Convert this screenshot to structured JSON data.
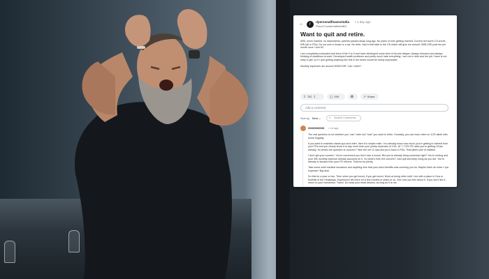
{
  "post": {
    "subreddit": "r/personalfinanceindia",
    "time": "• 1 day ago",
    "flair": "Proud Conservative/ABC",
    "title": "Want to quit and retire.",
    "body": [
      "60M, never married, no dependents, parents passed away long ago. No plans of ever getting married. Current net worth 2.5 crores INR (all in FDs). Do not own a house or a car. No debt. Had a brief stint in the US which will give me around 150$ USD post tax per month once I turn 62.",
      "I am completely exhausted and tired of the 9 to 5 and have developed some kind of chronic fatigue. Always stressed and always thinking of deadlines at work. Developed health problems and pretty much hate everything. I am not in debt and the job I have is not easy to get, so if I quit getting anything like this in the future would be nearly impossible.",
      "Monthly expenses are around 30000 INR. Can I retire?"
    ],
    "actions": {
      "upvotes": "752",
      "comments": "299",
      "awards": "",
      "share": "Share"
    },
    "comment_placeholder": "Add a comment",
    "sort_label": "Sort by:",
    "sort_value": "Best ⌄",
    "search_placeholder": "Search Comments"
  },
  "top_comment": {
    "user": "xxxxxxxxxx",
    "time": "• 1d ago",
    "body": [
      "The real question is not whether you \"can\" retire but \"how\" you want to retire. Honestly, you can even retire on 1CR albeit with some frugality.",
      "If you want to maintain status quo and retire, then it is simple math. You already know how much you're getting in interest from your FDs and you clearly know it is way more than your yearly expenses of 3.6L. At 7-7.5% FD rates you're getting 18 lpa already. So what's the question or concern? Take the net 12 lacs and put it back in FDs. That takes care of inflation.",
      "I don't get your concern. You're concerned you don't own a house. But you're already living somehow right? You're renting and your 30k monthly expense already accounts for it. So what's even the concern? Just quit and keep living as you are. You're already in surplus from your FD returns. That too by plenty.",
      "Take some solid medical insurance and anything else that your work benefits was covering you for. Maybe that's an extra 1 lpa expense? Big deal.",
      "Do this for a year or two. Then when you get bored, if you get bored. Work at doing other stuff. Live with a place in Goa or foothills of the Himalayas. Experience life there for a few months or years or so. See how you feel about it. If you don't like it, return to your hometown. Travel. Do what your heart desires, as long as it is not"
    ]
  }
}
